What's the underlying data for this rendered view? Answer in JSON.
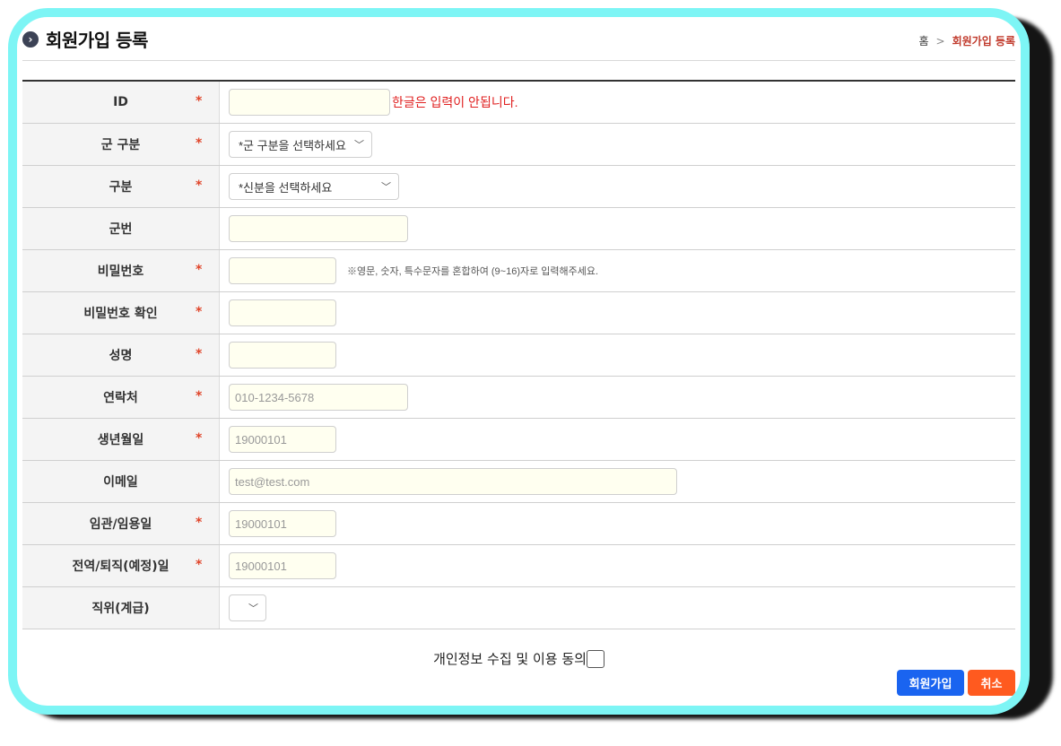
{
  "header": {
    "title": "회원가입 등록",
    "breadcrumb": {
      "home": "홈",
      "separator": ">",
      "current": "회원가입 등록"
    }
  },
  "form": {
    "required_mark": "*",
    "id": {
      "label": "ID",
      "value": "",
      "error": "한글은 입력이 안됩니다."
    },
    "unit": {
      "label": "군 구분",
      "selected": "*군 구분을 선택하세요"
    },
    "category": {
      "label": "구분",
      "selected": "*신분을 선택하세요"
    },
    "service_number": {
      "label": "군번",
      "value": ""
    },
    "password": {
      "label": "비밀번호",
      "hint": "※영문, 숫자, 특수문자를 혼합하여 (9~16)자로 입력해주세요."
    },
    "password_confirm": {
      "label": "비밀번호 확인"
    },
    "name": {
      "label": "성명",
      "value": ""
    },
    "phone": {
      "label": "연락처",
      "placeholder": "010-1234-5678"
    },
    "birth": {
      "label": "생년월일",
      "placeholder": "19000101"
    },
    "email": {
      "label": "이메일",
      "placeholder": "test@test.com"
    },
    "commission": {
      "label": "임관/임용일",
      "placeholder": "19000101"
    },
    "discharge": {
      "label": "전역/퇴직(예정)일",
      "placeholder": "19000101"
    },
    "rank": {
      "label": "직위(계급)",
      "selected": ""
    }
  },
  "agreement": {
    "label": "개인정보 수집 및 이용 동의",
    "checked": false
  },
  "buttons": {
    "join": "회원가입",
    "cancel": "취소"
  },
  "colors": {
    "frame": "#7df5f5",
    "required": "#e0452a",
    "error": "#e02020",
    "join_button": "#1a64f0",
    "cancel_button": "#ff5a1f",
    "breadcrumb_current": "#c0392b"
  }
}
